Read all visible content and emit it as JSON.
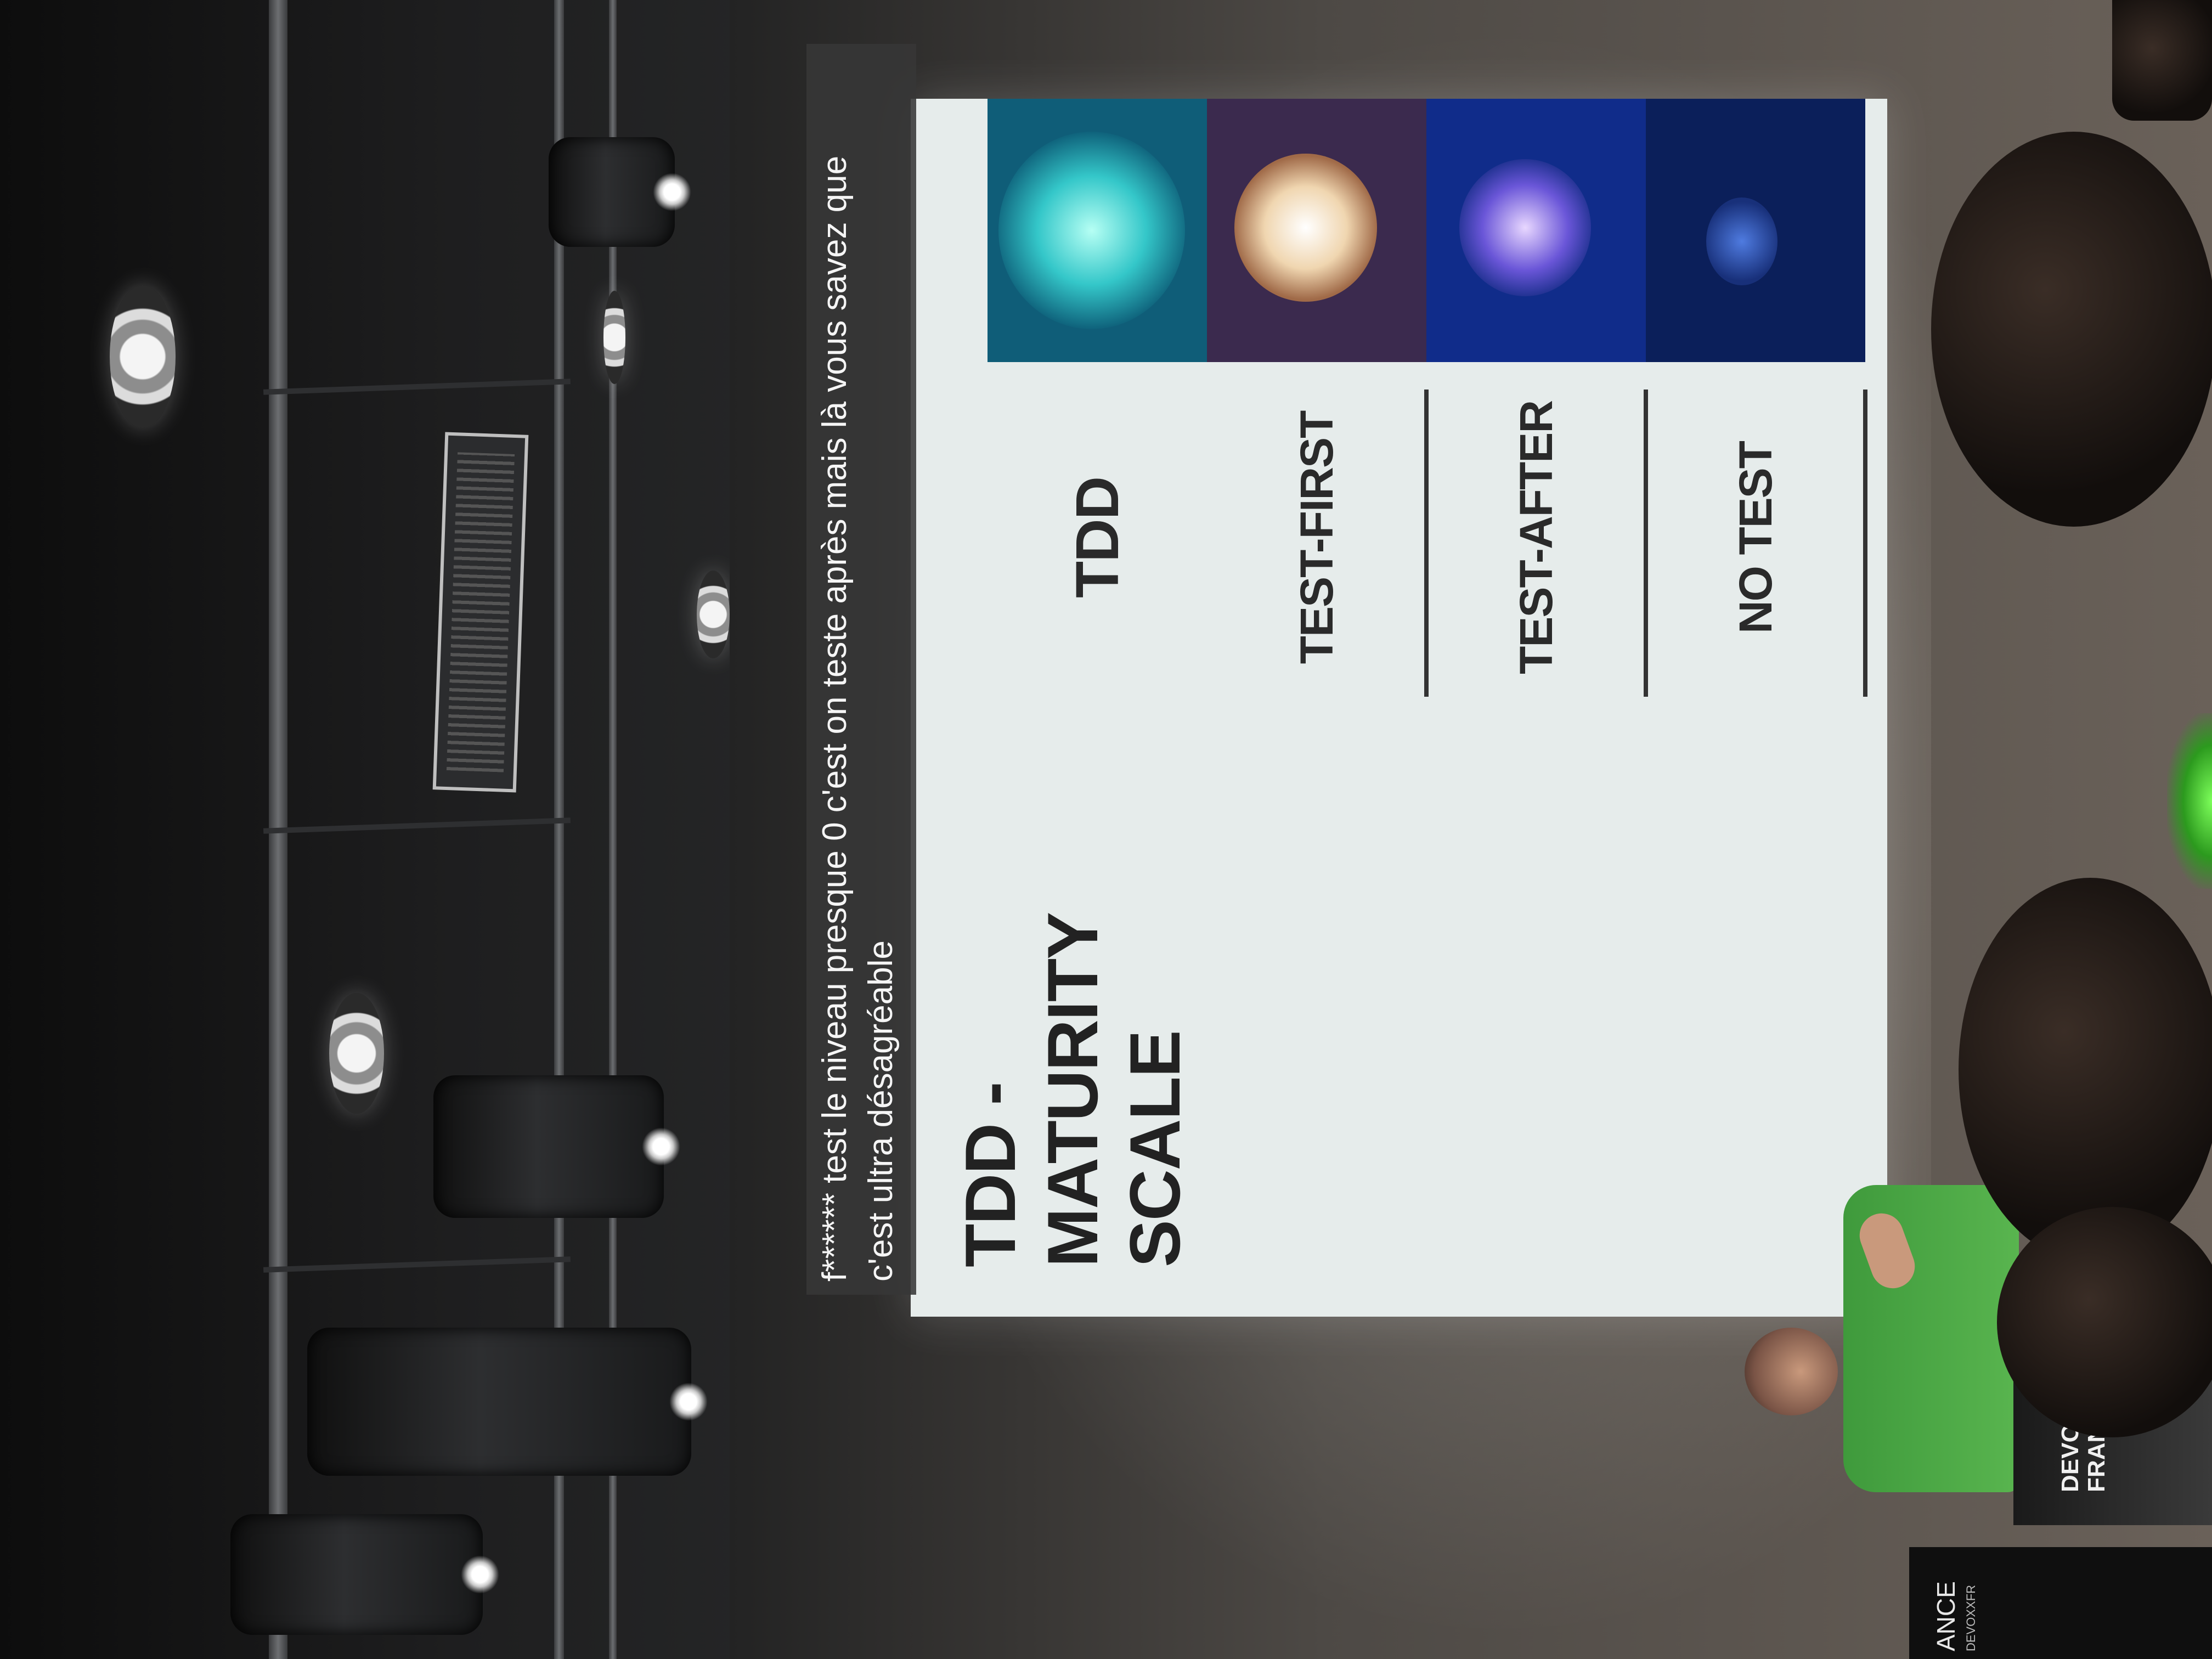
{
  "slide": {
    "title_line1": "TDD - MATURITY",
    "title_line2": "SCALE",
    "levels": [
      {
        "label": "NO TEST"
      },
      {
        "label": "TEST-AFTER"
      },
      {
        "label": "TEST-FIRST"
      },
      {
        "label": "TDD"
      }
    ]
  },
  "subtitles": {
    "line1": "f****** test le niveau presque 0 c'est on teste après mais là vous savez que",
    "line2": "c'est ultra désagréable"
  },
  "branding": {
    "logo_line1": "DEVOXX",
    "logo_line2": "FRANCE",
    "banner_text": "ANCE",
    "banner_sub": "DEVOXXFR"
  }
}
